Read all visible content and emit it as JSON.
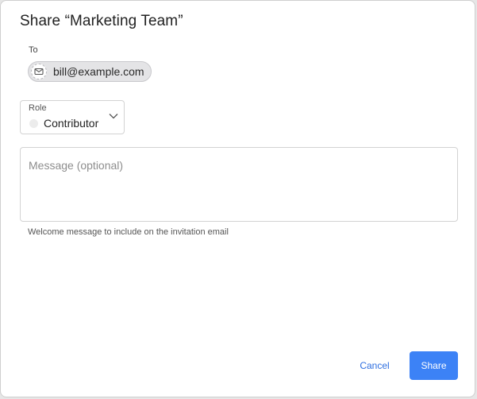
{
  "dialog": {
    "title": "Share “Marketing Team”"
  },
  "recipients": {
    "label": "To",
    "chips": [
      {
        "icon": "mail-icon",
        "text": "bill@example.com"
      }
    ]
  },
  "role": {
    "label": "Role",
    "value": "Contributor",
    "icon": "chevron-down-icon"
  },
  "message": {
    "placeholder": "Message (optional)",
    "value": "",
    "helper": "Welcome message to include on the invitation email"
  },
  "actions": {
    "cancel_label": "Cancel",
    "share_label": "Share"
  },
  "colors": {
    "accent": "#3c82f6",
    "link": "#2f6fe0"
  }
}
